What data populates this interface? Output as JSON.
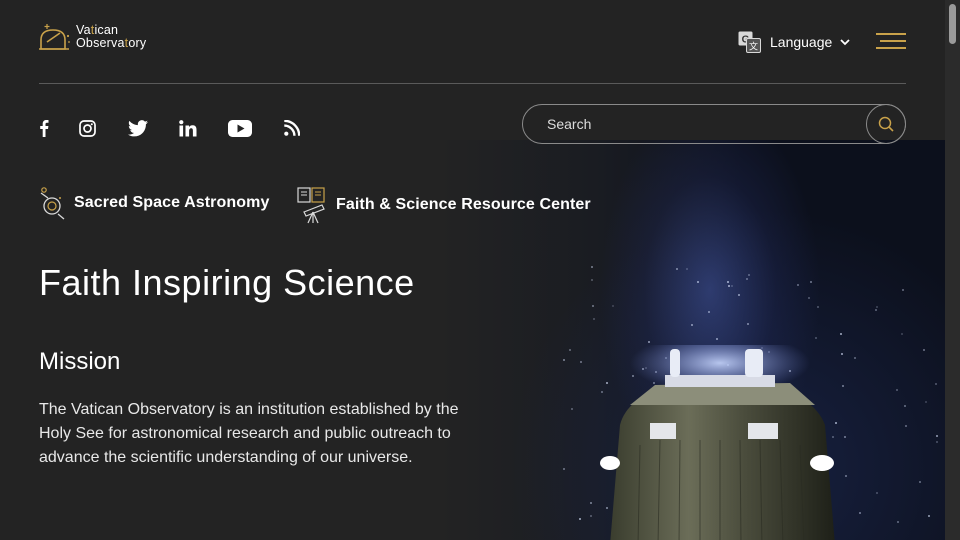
{
  "header": {
    "logo": {
      "line1_a": "Va",
      "line1_b": "t",
      "line1_c": "ican",
      "line2_a": "Observa",
      "line2_b": "t",
      "line2_c": "ory"
    },
    "language_label": "Language"
  },
  "social": {
    "items": [
      "facebook-icon",
      "instagram-icon",
      "twitter-icon",
      "linkedin-icon",
      "youtube-icon",
      "rss-icon"
    ]
  },
  "search": {
    "placeholder": "Search"
  },
  "quick_links": [
    {
      "label": "Sacred Space Astronomy",
      "icon": "astronomy-icon"
    },
    {
      "label": "Faith & Science Resource Center",
      "icon": "telescope-books-icon"
    }
  ],
  "hero": {
    "title": "Faith Inspiring Science",
    "mission_title": "Mission",
    "mission_text": "The Vatican Observatory is an institution established by the Holy See for astronomical research and public outreach to advance the scientific understanding of our universe."
  },
  "colors": {
    "accent": "#c9a24a",
    "background": "#232323",
    "text": "#ffffff"
  }
}
